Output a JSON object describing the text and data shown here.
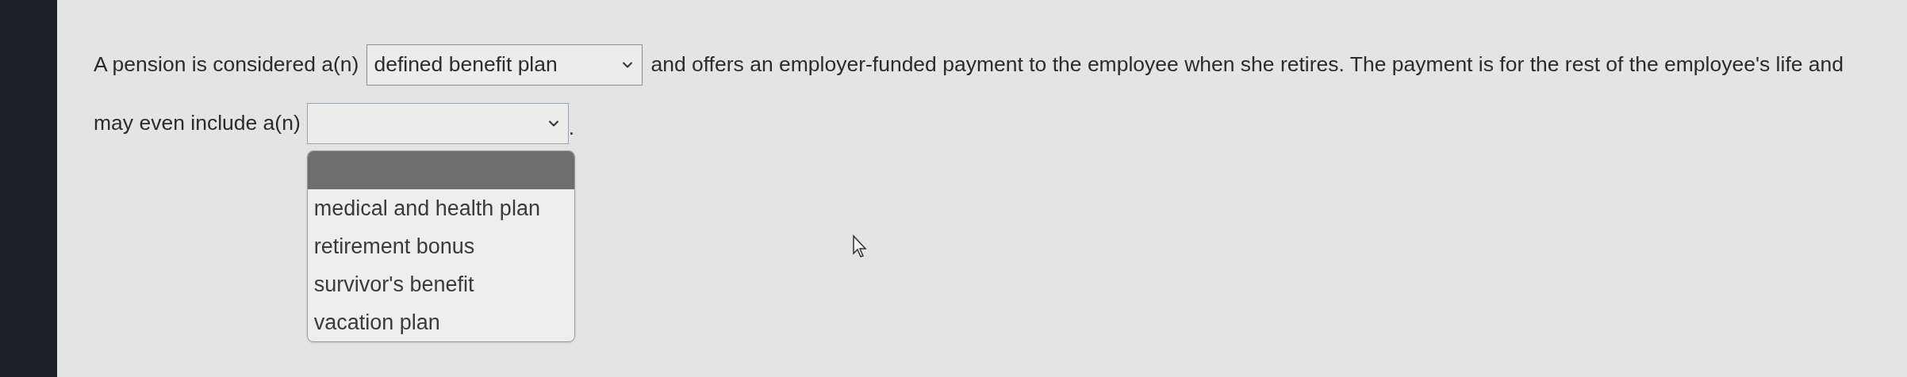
{
  "question": {
    "line_1_start": "A pension is considered a(n)",
    "select_1": {
      "value": "defined benefit plan",
      "expanded": false
    },
    "line_1_end": "and offers an employer-funded payment to the employee when she retires. The payment is for the rest of the employee's life and",
    "line_2_start": "may even include a(n)",
    "select_2": {
      "expanded": true,
      "options": [
        {
          "selected": true
        },
        {
          "label": "medical and health plan",
          "selected": false
        },
        {
          "label": "retirement bonus",
          "selected": false
        },
        {
          "label": "survivor's benefit",
          "selected": false
        },
        {
          "label": "vacation plan",
          "selected": false
        }
      ]
    },
    "line_2_end": "."
  }
}
